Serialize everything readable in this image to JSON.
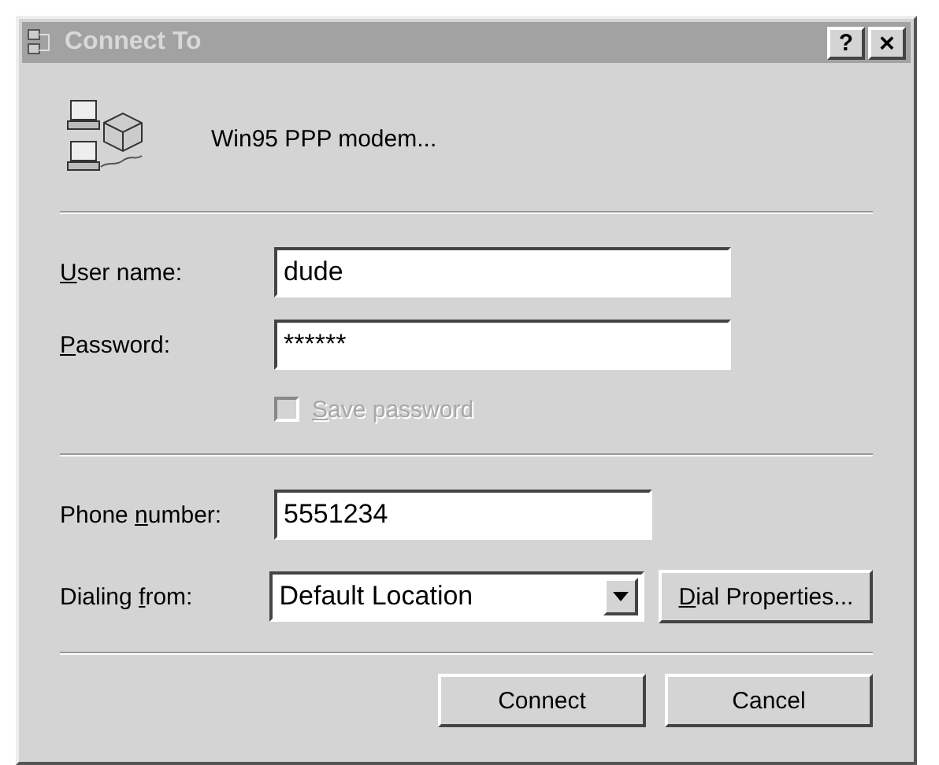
{
  "window": {
    "title": "Connect To",
    "active": false,
    "buttons": [
      {
        "kind": "help",
        "label": "?"
      },
      {
        "kind": "close",
        "label": "×"
      }
    ]
  },
  "connection": {
    "name": "Win95 PPP modem..."
  },
  "fields": [
    {
      "kind": "text",
      "label": {
        "key": "U",
        "after": "ser name:"
      },
      "value": "dude"
    },
    {
      "kind": "text",
      "label": {
        "key": "P",
        "after": "assword:"
      },
      "value": "******"
    }
  ],
  "save_password": {
    "label": {
      "key": "S",
      "after": "ave password"
    },
    "checked": false,
    "disabled": true
  },
  "phone": {
    "label": {
      "before": "Phone ",
      "key": "n",
      "after": "umber:"
    },
    "value": "5551234"
  },
  "dialing": {
    "label": {
      "before": "Dialing ",
      "key": "f",
      "after": "rom:"
    },
    "value": "Default Location",
    "button": {
      "key": "D",
      "after": "ial Properties..."
    }
  },
  "buttons": [
    "Connect",
    "Cancel"
  ]
}
